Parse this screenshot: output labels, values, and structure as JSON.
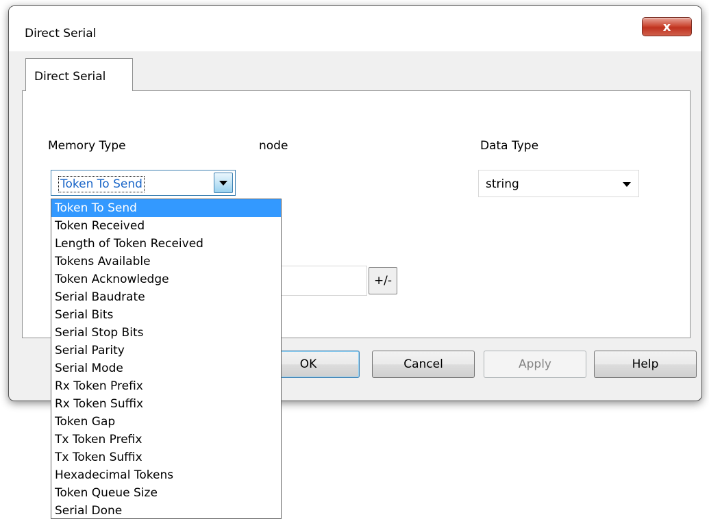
{
  "dialog": {
    "title": "Direct Serial",
    "close_label": "x"
  },
  "tab": {
    "label": "Direct Serial"
  },
  "labels": {
    "memory_type": "Memory Type",
    "node": "node",
    "data_type": "Data Type"
  },
  "memory_type": {
    "value": "Token To Send",
    "options": [
      "Token To Send",
      "Token Received",
      "Length of Token Received",
      "Tokens Available",
      "Token Acknowledge",
      "Serial Baudrate",
      "Serial Bits",
      "Serial Stop Bits",
      "Serial Parity",
      "Serial Mode",
      "Rx Token Prefix",
      "Rx Token Suffix",
      "Token Gap",
      "Tx Token Prefix",
      "Tx Token Suffix",
      "Hexadecimal Tokens",
      "Token Queue Size",
      "Serial Done"
    ]
  },
  "data_type": {
    "value": "string"
  },
  "sign_toggle_label": "+/-",
  "buttons": {
    "ok": "OK",
    "cancel": "Cancel",
    "apply": "Apply",
    "help": "Help"
  }
}
